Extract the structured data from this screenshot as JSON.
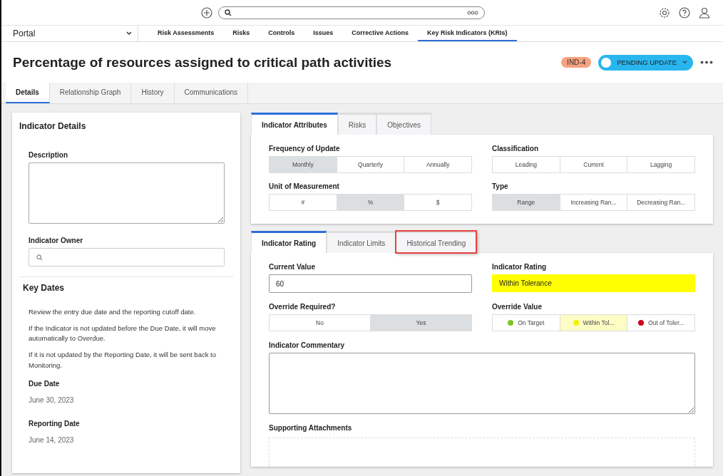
{
  "nav": {
    "portal": "Portal",
    "items": [
      {
        "label": "Risk Assessments",
        "selected": false
      },
      {
        "label": "Risks",
        "selected": false
      },
      {
        "label": "Controls",
        "selected": false
      },
      {
        "label": "Issues",
        "selected": false
      },
      {
        "label": "Corrective Actions",
        "selected": false
      },
      {
        "label": "Key Risk Indicators (KRIs)",
        "selected": true
      }
    ]
  },
  "page": {
    "title": "Percentage of resources assigned to critical path activities",
    "id_badge": "IND-4",
    "status": "PENDING UPDATE"
  },
  "tabs": [
    {
      "label": "Details",
      "selected": true
    },
    {
      "label": "Relationship Graph",
      "selected": false
    },
    {
      "label": "History",
      "selected": false
    },
    {
      "label": "Communications",
      "selected": false
    }
  ],
  "details": {
    "title": "Indicator Details",
    "description": {
      "label": "Description"
    },
    "owner": {
      "label": "Indicator Owner"
    },
    "key_dates": {
      "title": "Key Dates",
      "paragraphs": [
        "Review the entry due date and the reporting cutoff date.",
        "If the Indicator is not updated before the Due Date, it will move automatically to Overdue.",
        "If it is not updated by the Reporting Date, it will be sent back to Monitoring."
      ],
      "dates": [
        {
          "label": "Due Date",
          "value": "June 30, 2023"
        },
        {
          "label": "Reporting Date",
          "value": "June 14, 2023"
        }
      ]
    }
  },
  "attributes": {
    "tabs": [
      {
        "label": "Indicator Attributes",
        "selected": true
      },
      {
        "label": "Risks",
        "selected": false
      },
      {
        "label": "Objectives",
        "selected": false
      }
    ],
    "groups": [
      {
        "label": "Frequency of Update",
        "options": [
          {
            "label": "Monthly",
            "selected": true
          },
          {
            "label": "Quarterly",
            "selected": false
          },
          {
            "label": "Annually",
            "selected": false
          }
        ]
      },
      {
        "label": "Classification",
        "options": [
          {
            "label": "Leading",
            "selected": false
          },
          {
            "label": "Current",
            "selected": false
          },
          {
            "label": "Lagging",
            "selected": false
          }
        ]
      },
      {
        "label": "Unit of Measurement",
        "options": [
          {
            "label": "#",
            "selected": false
          },
          {
            "label": "%",
            "selected": true
          },
          {
            "label": "$",
            "selected": false
          }
        ]
      },
      {
        "label": "Type",
        "options": [
          {
            "label": "Range",
            "selected": true
          },
          {
            "label": "Increasing Ran...",
            "selected": false
          },
          {
            "label": "Decreasing Ran...",
            "selected": false
          }
        ]
      }
    ]
  },
  "rating": {
    "tabs": [
      {
        "label": "Indicator Rating",
        "selected": true,
        "highlighted": false
      },
      {
        "label": "Indicator Limits",
        "selected": false,
        "highlighted": false
      },
      {
        "label": "Historical Trending",
        "selected": false,
        "highlighted": true
      }
    ],
    "current_value": {
      "label": "Current Value",
      "value": "60"
    },
    "indicator_rating": {
      "label": "Indicator Rating",
      "value": "Within Tolerance"
    },
    "override_required": {
      "label": "Override Required?",
      "options": [
        {
          "label": "No",
          "selected": false
        },
        {
          "label": "Yes",
          "selected": true
        }
      ]
    },
    "override_value": {
      "label": "Override Value",
      "options": [
        {
          "label": "On Target",
          "selected": false,
          "color": "#7cc524"
        },
        {
          "label": "Within Tol...",
          "selected": true,
          "color": "#f5f200"
        },
        {
          "label": "Out of Toler...",
          "selected": false,
          "color": "#d0021b"
        }
      ]
    },
    "commentary": {
      "label": "Indicator Commentary"
    },
    "attachments": {
      "label": "Supporting Attachments"
    }
  }
}
